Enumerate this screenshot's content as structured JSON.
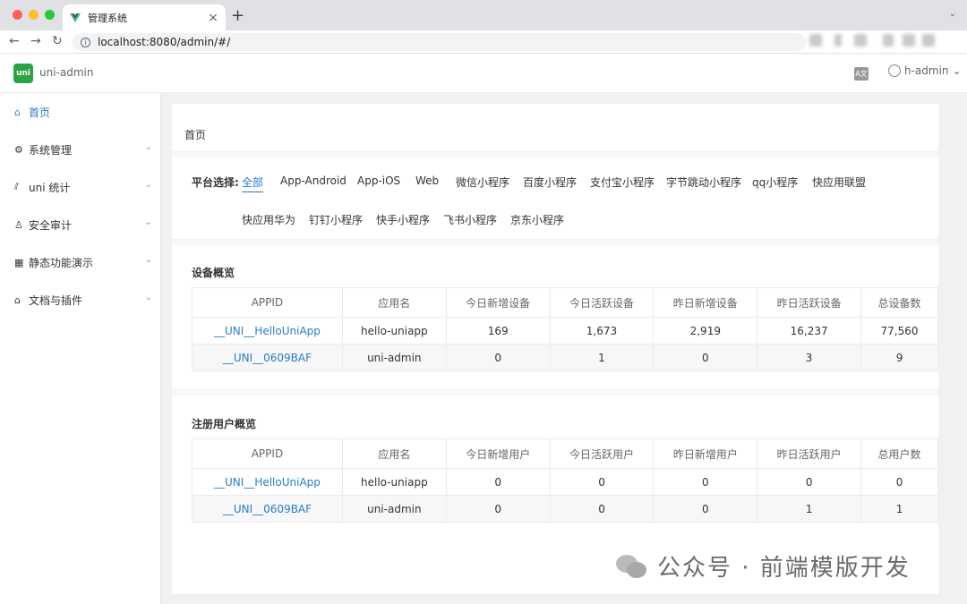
{
  "browser": {
    "tab_title": "管理系统",
    "tab_close": "×",
    "new_tab": "+",
    "url": "localhost:8080/admin/#/",
    "back": "←",
    "forward": "→",
    "reload": "↻",
    "traffic_lights": [
      "#ff5f57",
      "#febc2e",
      "#28c840"
    ]
  },
  "header": {
    "logo_text": "uni",
    "app_name": "uni-admin",
    "lang_icon": "translate-icon",
    "user_name": "h-admin",
    "user_chevron": "⌄"
  },
  "sidebar": {
    "items": [
      {
        "icon": "⌂",
        "label": "首页",
        "active": true
      },
      {
        "icon": "⚙",
        "label": "系统管理",
        "chev": "⌄"
      },
      {
        "icon": "⫽",
        "label": "uni 统计",
        "chev": "⌄"
      },
      {
        "icon": "♙",
        "label": "安全审计",
        "chev": "⌄"
      },
      {
        "icon": "▦",
        "label": "静态功能演示",
        "chev": "⌄"
      },
      {
        "icon": "⌂",
        "label": "文档与插件",
        "chev": "⌄"
      }
    ]
  },
  "breadcrumb": "首页",
  "platform": {
    "label": "平台选择:",
    "options": [
      "全部",
      "App-Android",
      "App-iOS",
      "Web",
      "微信小程序",
      "百度小程序",
      "支付宝小程序",
      "字节跳动小程序",
      "qq小程序",
      "快应用联盟",
      "快应用华为",
      "钉钉小程序",
      "快手小程序",
      "飞书小程序",
      "京东小程序"
    ],
    "selected": "全部"
  },
  "device_overview": {
    "title": "设备概览",
    "headers": [
      "APPID",
      "应用名",
      "今日新增设备",
      "今日活跃设备",
      "昨日新增设备",
      "昨日活跃设备",
      "总设备数"
    ],
    "rows": [
      [
        "__UNI__HelloUniApp",
        "hello-uniapp",
        "169",
        "1,673",
        "2,919",
        "16,237",
        "77,560"
      ],
      [
        "__UNI__0609BAF",
        "uni-admin",
        "0",
        "1",
        "0",
        "3",
        "9"
      ]
    ]
  },
  "user_overview": {
    "title": "注册用户概览",
    "headers": [
      "APPID",
      "应用名",
      "今日新增用户",
      "今日活跃用户",
      "昨日新增用户",
      "昨日活跃用户",
      "总用户数"
    ],
    "rows": [
      [
        "__UNI__HelloUniApp",
        "hello-uniapp",
        "0",
        "0",
        "0",
        "0",
        "0"
      ],
      [
        "__UNI__0609BAF",
        "uni-admin",
        "0",
        "0",
        "0",
        "1",
        "1"
      ]
    ]
  },
  "watermark": "公众号 · 前端模版开发",
  "colors": {
    "accent": "#2a7cc7",
    "brand_green": "#2ba245"
  }
}
